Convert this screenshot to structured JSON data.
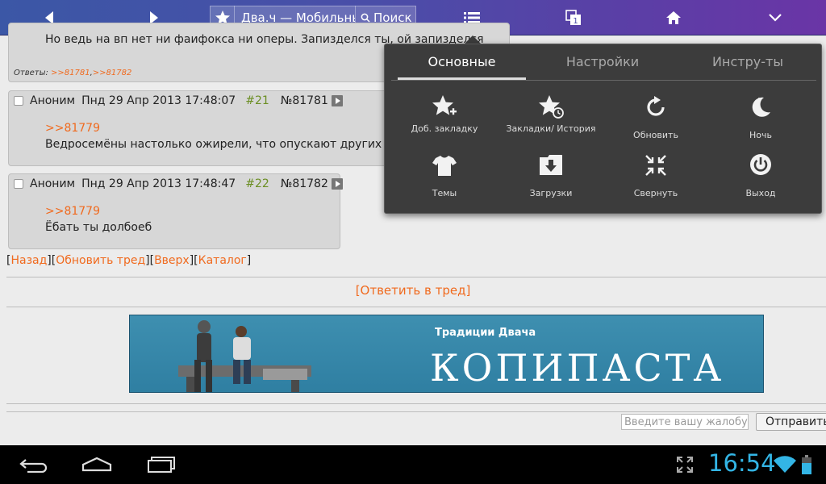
{
  "toolbar": {
    "title": "Два.ч — Мобильны",
    "search_label": "Поиск"
  },
  "posts": {
    "prev": {
      "text": "Но ведь на вп нет ни фаифокса ни оперы. Запизделся ты, ой запизделся",
      "replies_label": "Ответы:",
      "reply_1": ">>81781",
      "reply_2": ">>81782"
    },
    "p21": {
      "author": "Аноним",
      "date": "Пнд 29 Апр 2013 17:48:07",
      "num": "#21",
      "no": "№81781",
      "ref": ">>81779",
      "text": "Ведросемёны настолько ожирели, что опускают других ведросемёнов временами."
    },
    "p22": {
      "author": "Аноним",
      "date": "Пнд 29 Апр 2013 17:48:47",
      "num": "#22",
      "no": "№81782",
      "ref": ">>81779",
      "text": "Ёбать ты долбоеб"
    }
  },
  "nav": {
    "back": "Назад",
    "refresh": "Обновить тред",
    "up": "Вверх",
    "catalog": "Каталог"
  },
  "reply_link": "[Ответить в тред]",
  "banner": {
    "subtitle": "Традиции Двача",
    "title": "КОПИПАСТА"
  },
  "complaint": {
    "placeholder": "Введите вашу жалобу",
    "send_label": "Отправить"
  },
  "popup": {
    "tabs": [
      "Основные",
      "Настройки",
      "Инстру-ты"
    ],
    "items": [
      {
        "label": "Доб. закладку",
        "icon": "star-add-icon"
      },
      {
        "label": "Закладки/ История",
        "icon": "star-history-icon"
      },
      {
        "label": "Обновить",
        "icon": "refresh-icon"
      },
      {
        "label": "Ночь",
        "icon": "moon-icon"
      },
      {
        "label": "Темы",
        "icon": "tshirt-icon"
      },
      {
        "label": "Загрузки",
        "icon": "download-icon"
      },
      {
        "label": "Свернуть",
        "icon": "collapse-icon"
      },
      {
        "label": "Выход",
        "icon": "power-icon"
      }
    ]
  },
  "status_bar": {
    "time": "16:54"
  },
  "colors": {
    "accent_orange": "#f06a1e",
    "post_num_green": "#6b8e23",
    "clock_blue": "#33b5e5"
  }
}
